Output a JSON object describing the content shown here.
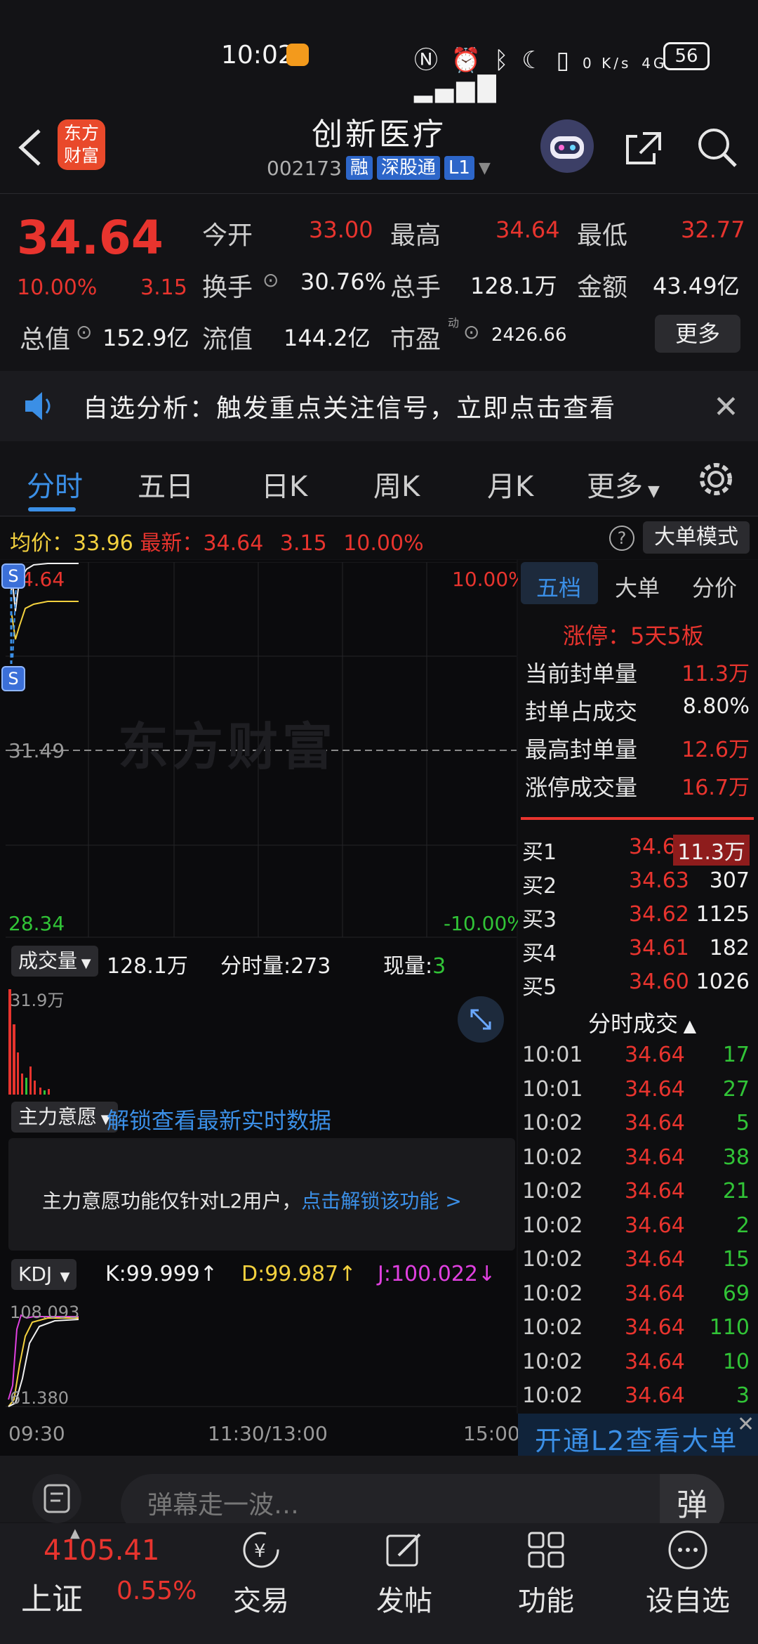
{
  "status": {
    "time": "10:02",
    "net_speed": "0 K/s",
    "signal": "4G",
    "battery": "56"
  },
  "header": {
    "logo_line1": "东方",
    "logo_line2": "财富",
    "name": "创新医疗",
    "code": "002173",
    "tags": [
      "融",
      "深股通",
      "L1"
    ]
  },
  "quote": {
    "price": "34.64",
    "pct": "10.00%",
    "chg": "3.15",
    "fields": [
      {
        "label": "今开",
        "value": "33.00",
        "color": "#e8342e"
      },
      {
        "label": "最高",
        "value": "34.64",
        "color": "#e8342e"
      },
      {
        "label": "最低",
        "value": "32.77",
        "color": "#e8342e"
      },
      {
        "label": "换手",
        "value": "30.76%",
        "color": "#f0f0f0"
      },
      {
        "label": "总手",
        "value": "128.1万",
        "color": "#f0f0f0"
      },
      {
        "label": "金额",
        "value": "43.49亿",
        "color": "#f0f0f0"
      },
      {
        "label": "总值",
        "value": "152.9亿",
        "color": "#f0f0f0"
      },
      {
        "label": "流值",
        "value": "144.2亿",
        "color": "#f0f0f0"
      },
      {
        "label": "市盈",
        "value": "2426.66",
        "color": "#f0f0f0"
      }
    ],
    "pe_sup": "动",
    "more": "更多"
  },
  "notice": {
    "text": "自选分析：触发重点关注信号，立即点击查看"
  },
  "tabs": [
    "分时",
    "五日",
    "日K",
    "周K",
    "月K",
    "更多"
  ],
  "info": {
    "avg_label": "均价：",
    "avg": "33.96",
    "last_label": "最新：",
    "last": "34.64",
    "chg": "3.15",
    "pct": "10.00%",
    "big_order_btn": "大单模式"
  },
  "chart": {
    "top_price": "34.64",
    "mid_price": "31.49",
    "low_price": "28.34",
    "top_pct": "10.00%",
    "low_pct": "-10.00%",
    "watermark": "东方财富",
    "marker": "S"
  },
  "volume": {
    "select": "成交量",
    "total": "128.1万",
    "fenshi": "分时量:273",
    "xian_label": "现量:",
    "xian_value": "3",
    "max": "31.9万"
  },
  "zhuli": {
    "select": "主力意愿",
    "unlock_link": "解锁查看最新实时数据",
    "note": "主力意愿功能仅针对L2用户，",
    "note_link": "点击解锁该功能 >"
  },
  "kdj": {
    "select": "KDJ",
    "k": "K:99.999",
    "d": "D:99.987",
    "j": "J:100.022",
    "top": "108.093",
    "bottom": "61.380"
  },
  "time_axis": [
    "09:30",
    "11:30/13:00",
    "15:00"
  ],
  "right": {
    "tabs": [
      "五档",
      "大单",
      "分价"
    ],
    "limit_label": "涨停：5天5板",
    "limit_rows": [
      {
        "label": "当前封单量",
        "value": "11.3万",
        "color": "#e8342e"
      },
      {
        "label": "封单占成交",
        "value": "8.80%",
        "color": "#f0f0f0"
      },
      {
        "label": "最高封单量",
        "value": "12.6万",
        "color": "#e8342e"
      },
      {
        "label": "涨停成交量",
        "value": "16.7万",
        "color": "#e8342e"
      }
    ],
    "buy": [
      {
        "label": "买1",
        "price": "34.64",
        "vol": "11.3万"
      },
      {
        "label": "买2",
        "price": "34.63",
        "vol": "307"
      },
      {
        "label": "买3",
        "price": "34.62",
        "vol": "1125"
      },
      {
        "label": "买4",
        "price": "34.61",
        "vol": "182"
      },
      {
        "label": "买5",
        "price": "34.60",
        "vol": "1026"
      }
    ],
    "ticks_title": "分时成交",
    "ticks": [
      {
        "t": "10:01",
        "p": "34.64",
        "v": "17"
      },
      {
        "t": "10:01",
        "p": "34.64",
        "v": "27"
      },
      {
        "t": "10:02",
        "p": "34.64",
        "v": "5"
      },
      {
        "t": "10:02",
        "p": "34.64",
        "v": "38"
      },
      {
        "t": "10:02",
        "p": "34.64",
        "v": "21"
      },
      {
        "t": "10:02",
        "p": "34.64",
        "v": "2"
      },
      {
        "t": "10:02",
        "p": "34.64",
        "v": "15"
      },
      {
        "t": "10:02",
        "p": "34.64",
        "v": "69"
      },
      {
        "t": "10:02",
        "p": "34.64",
        "v": "110"
      },
      {
        "t": "10:02",
        "p": "34.64",
        "v": "10"
      },
      {
        "t": "10:02",
        "p": "34.64",
        "v": "3"
      }
    ],
    "l2_banner": "开通L2查看大单"
  },
  "comment": {
    "placeholder": "弹幕走一波…",
    "danmu": "弹"
  },
  "bottom": {
    "index_value": "4105.41",
    "index_name": "上证",
    "index_pct": "0.55%",
    "nav": [
      "交易",
      "发帖",
      "功能",
      "设自选"
    ]
  }
}
